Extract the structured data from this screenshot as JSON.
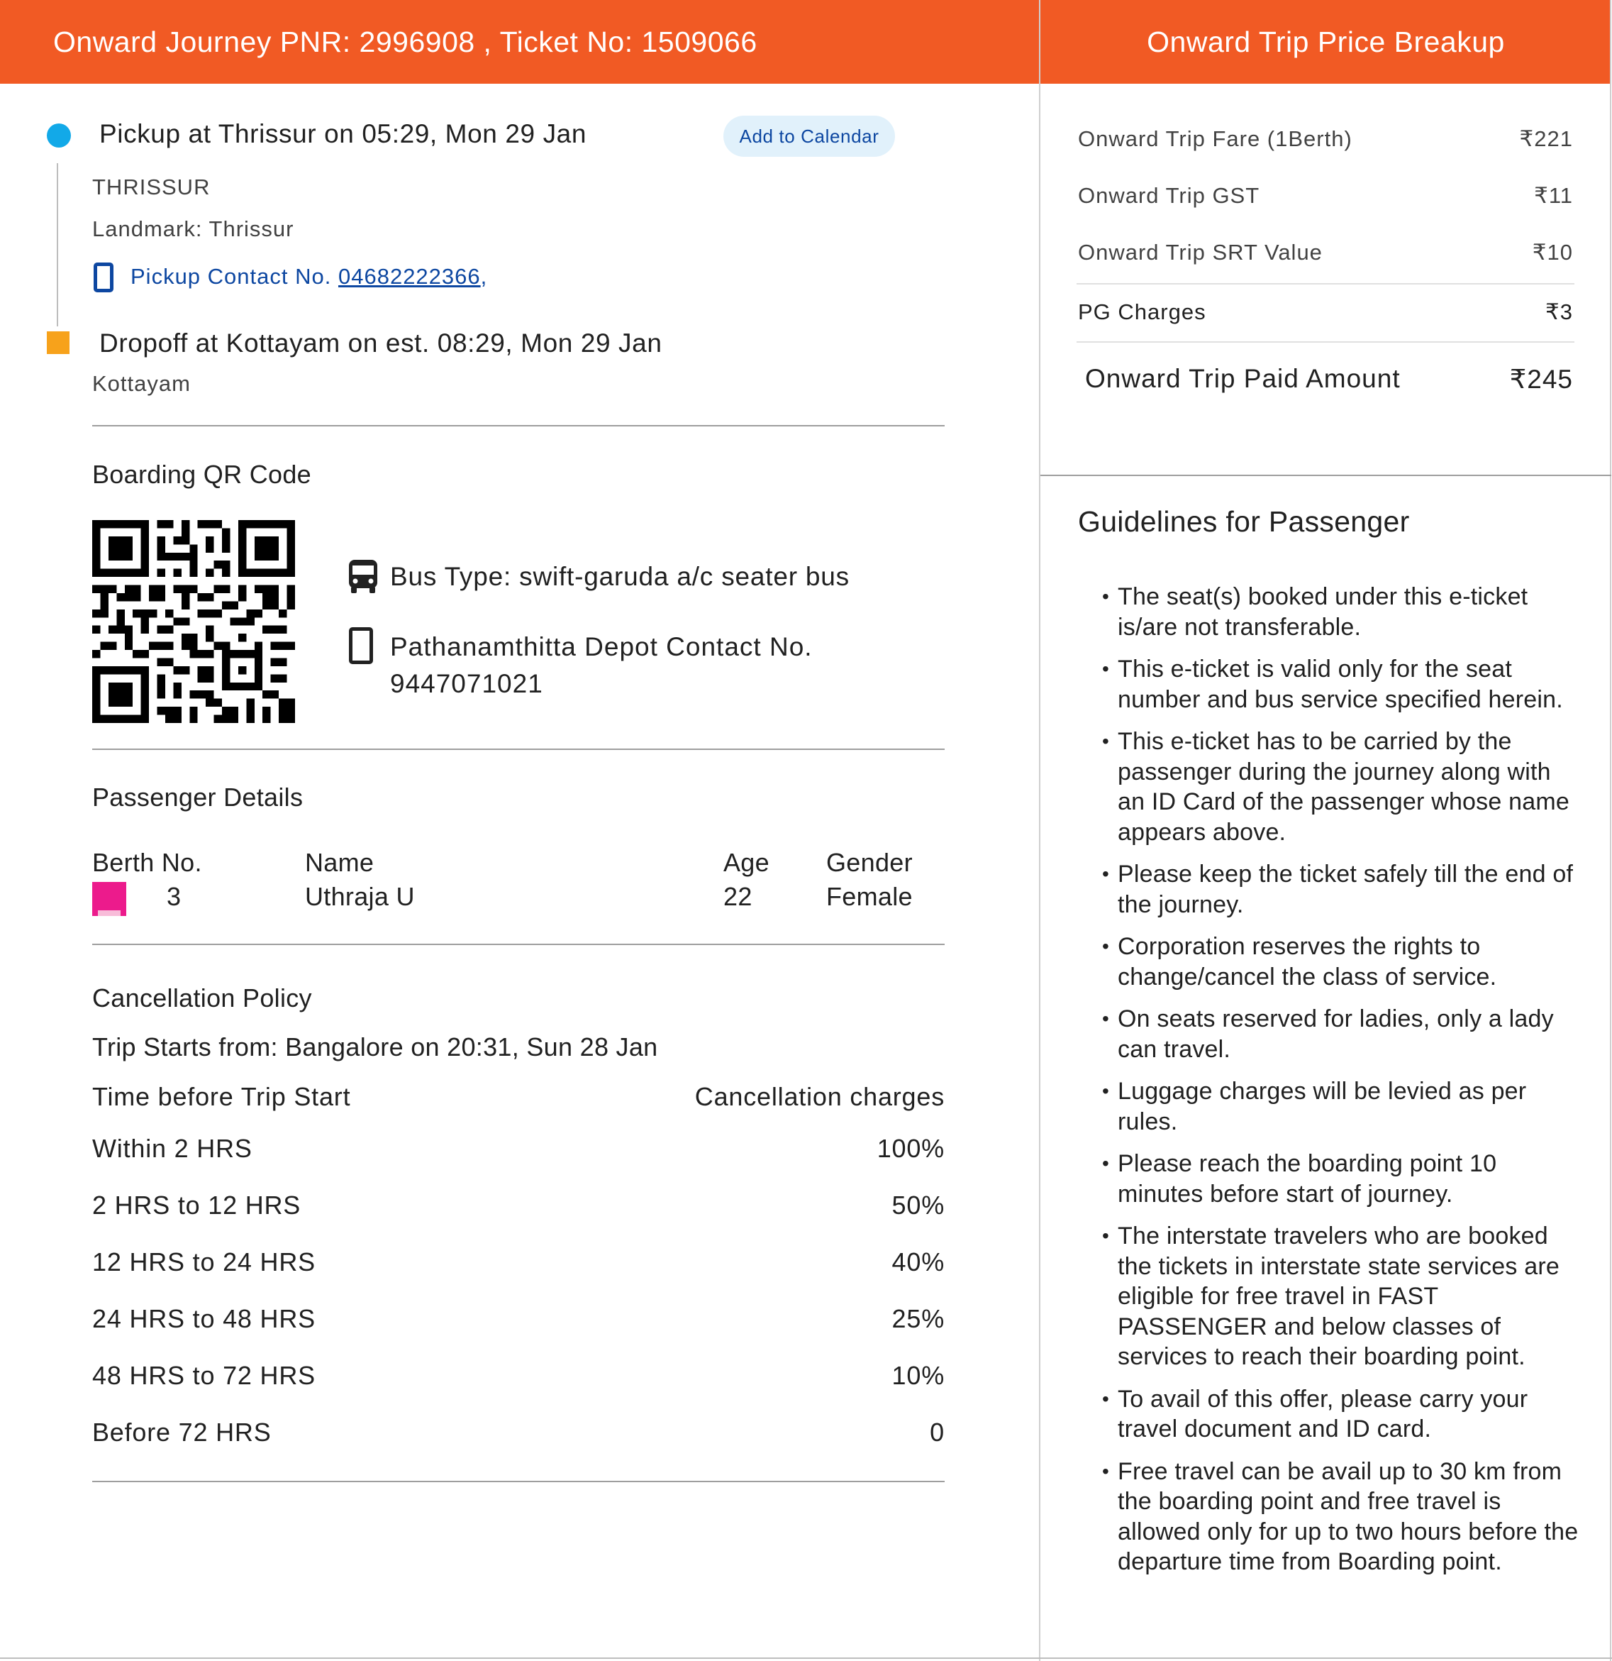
{
  "header": {
    "journey_title": "Onward Journey PNR: 2996908 , Ticket No: 1509066",
    "price_title": "Onward Trip Price Breakup"
  },
  "journey": {
    "pickup_title": "Pickup at Thrissur on 05:29, Mon 29 Jan",
    "add_to_calendar": "Add to Calendar",
    "pickup_city": "THRISSUR",
    "landmark": "Landmark: Thrissur",
    "pickup_contact_label": "Pickup Contact No.",
    "pickup_contact_number": "04682222366",
    "pickup_contact_suffix": ",",
    "dropoff_title": "Dropoff at Kottayam on est. 08:29, Mon 29 Jan",
    "dropoff_city": "Kottayam"
  },
  "colors": {
    "header": "#f15a24",
    "pickup_dot": "#12a9e8",
    "dropoff_square": "#f7a21b",
    "berth": "#ec1b8c",
    "link": "#0d47a1"
  },
  "boarding": {
    "title": "Boarding QR Code",
    "bus_type": "Bus Type: swift-garuda a/c seater bus",
    "depot_contact_line1": "Pathanamthitta Depot Contact No.",
    "depot_contact_line2": "9447071021"
  },
  "passenger": {
    "title": "Passenger Details",
    "headers": {
      "berth": "Berth No.",
      "name": "Name",
      "age": "Age",
      "gender": "Gender"
    },
    "rows": [
      {
        "berth": "3",
        "name": "Uthraja U",
        "age": "22",
        "gender": "Female"
      }
    ]
  },
  "cancellation": {
    "title": "Cancellation Policy",
    "trip_starts": "Trip Starts from: Bangalore on 20:31, Sun 28 Jan",
    "col_time": "Time before Trip Start",
    "col_charges": "Cancellation charges",
    "rows": [
      {
        "time": "Within 2 HRS",
        "charge": "100%"
      },
      {
        "time": "2 HRS to 12 HRS",
        "charge": "50%"
      },
      {
        "time": "12 HRS to 24 HRS",
        "charge": "40%"
      },
      {
        "time": "24 HRS to 48 HRS",
        "charge": "25%"
      },
      {
        "time": "48 HRS to 72 HRS",
        "charge": "10%"
      },
      {
        "time": "Before 72 HRS",
        "charge": "0"
      }
    ]
  },
  "price": {
    "rows": [
      {
        "label": "Onward Trip Fare (1Berth)",
        "value": "₹221"
      },
      {
        "label": "Onward Trip GST",
        "value": "₹11"
      },
      {
        "label": "Onward Trip SRT Value",
        "value": "₹10"
      }
    ],
    "pg_label": "PG Charges",
    "pg_value": "₹3",
    "paid_label": "Onward Trip Paid Amount",
    "paid_value": "₹245"
  },
  "guidelines": {
    "title": "Guidelines for Passenger",
    "items": [
      "The seat(s) booked under this e-ticket is/are not transferable.",
      "This e-ticket is valid only for the seat number and bus service specified herein.",
      "This e-ticket has to be carried by the passenger during the journey along with an ID Card of the passenger whose name appears above.",
      "Please keep the ticket safely till the end of the journey.",
      "Corporation reserves the rights to change/cancel the class of service.",
      "On seats reserved for ladies, only a lady can travel.",
      "Luggage charges will be levied as per rules.",
      "Please reach the boarding point 10 minutes before start of journey.",
      "The interstate travelers who are booked the tickets in interstate state services are eligible for free travel in FAST PASSENGER and below classes of services to reach their boarding point.",
      "To avail of this offer, please carry your travel document and ID card.",
      "Free travel can be avail up to 30 km from the boarding point and free travel is allowed only for up to two hours before the departure time from Boarding point."
    ]
  }
}
